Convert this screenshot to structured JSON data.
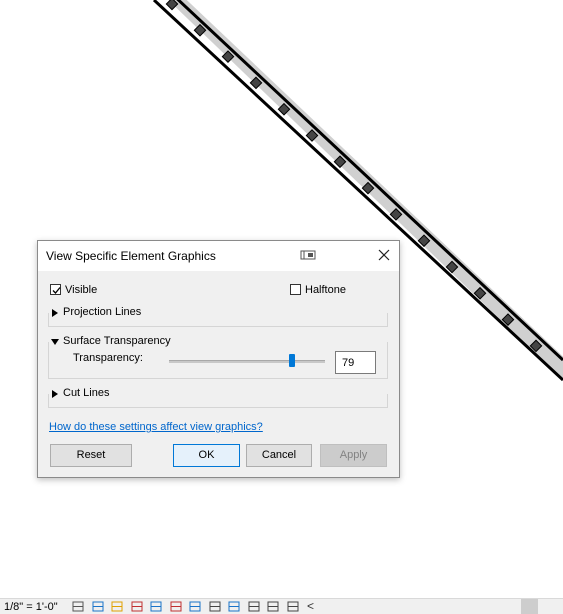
{
  "dialog": {
    "title": "View Specific Element Graphics",
    "visible": {
      "label": "Visible",
      "checked": true
    },
    "halftone": {
      "label": "Halftone",
      "checked": false
    },
    "projection_lines": {
      "label": "Projection Lines",
      "expanded": false
    },
    "surface_transparency": {
      "label": "Surface Transparency",
      "expanded": true,
      "transparency_label": "Transparency:",
      "transparency_value": "79",
      "slider_percent": 79
    },
    "cut_lines": {
      "label": "Cut Lines",
      "expanded": false
    },
    "help_link": "How do these settings affect view graphics?",
    "buttons": {
      "reset": "Reset",
      "ok": "OK",
      "cancel": "Cancel",
      "apply": "Apply"
    }
  },
  "status_bar": {
    "scale": "1/8\" = 1'-0\"",
    "icons": [
      "detail-level-icon",
      "visual-style-icon",
      "sun-path-icon",
      "shadows-icon",
      "crop-view-icon",
      "show-crop-icon",
      "temporary-hide-icon",
      "reveal-hidden-icon",
      "highlight-icon",
      "worksharing-icon",
      "analytical-model-icon",
      "constraints-icon"
    ],
    "arrow": "<"
  },
  "colors": {
    "accent": "#0078d7",
    "link": "#0066cc",
    "dialog_bg": "#f0f0f0"
  }
}
